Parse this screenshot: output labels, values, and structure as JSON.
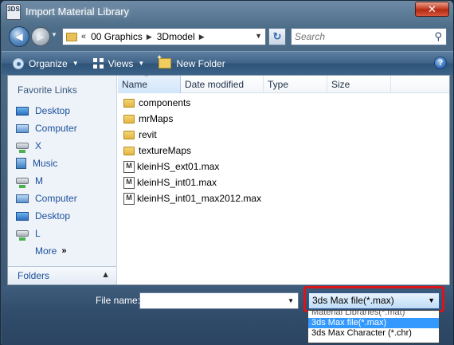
{
  "window": {
    "title": "Import Material Library",
    "app_icon_text": "3DS",
    "close_glyph": "✕"
  },
  "address_bar": {
    "chevron": "«",
    "crumbs": [
      "00 Graphics",
      "3Dmodel"
    ],
    "separator": "▶",
    "search_placeholder": "Search"
  },
  "toolbar": {
    "organize_label": "Organize",
    "views_label": "Views",
    "new_folder_label": "New Folder",
    "help_glyph": "?"
  },
  "nav_pane": {
    "favorite_links_title": "Favorite Links",
    "items": [
      {
        "label": "Desktop",
        "icon": "desktop-icon"
      },
      {
        "label": "Computer",
        "icon": "computer-icon"
      },
      {
        "label": "X",
        "icon": "network-drive-icon"
      },
      {
        "label": "Music",
        "icon": "music-icon"
      },
      {
        "label": "M",
        "icon": "network-drive-icon"
      },
      {
        "label": "Computer",
        "icon": "computer-icon"
      },
      {
        "label": "Desktop",
        "icon": "desktop-icon"
      },
      {
        "label": "L",
        "icon": "network-drive-icon"
      }
    ],
    "more_label": "More",
    "more_chevron": "»",
    "folders_label": "Folders",
    "folders_chevron": "▲"
  },
  "file_list": {
    "columns": [
      "Name",
      "Date modified",
      "Type",
      "Size"
    ],
    "rows": [
      {
        "name": "components",
        "kind": "folder"
      },
      {
        "name": "mrMaps",
        "kind": "folder"
      },
      {
        "name": "revit",
        "kind": "folder"
      },
      {
        "name": "textureMaps",
        "kind": "folder"
      },
      {
        "name": "kleinHS_ext01.max",
        "kind": "max"
      },
      {
        "name": "kleinHS_int01.max",
        "kind": "max"
      },
      {
        "name": "kleinHS_int01_max2012.max",
        "kind": "max"
      }
    ]
  },
  "bottom": {
    "file_name_label": "File name:",
    "file_name_value": "",
    "file_type_selected": "3ds Max file(*.max)",
    "file_type_options": [
      "Material Libraries(*.mat)",
      "3ds Max file(*.max)",
      "3ds Max Character (*.chr)"
    ],
    "highlight_color": "#d9141a",
    "selected_option_color": "#3399ff"
  }
}
